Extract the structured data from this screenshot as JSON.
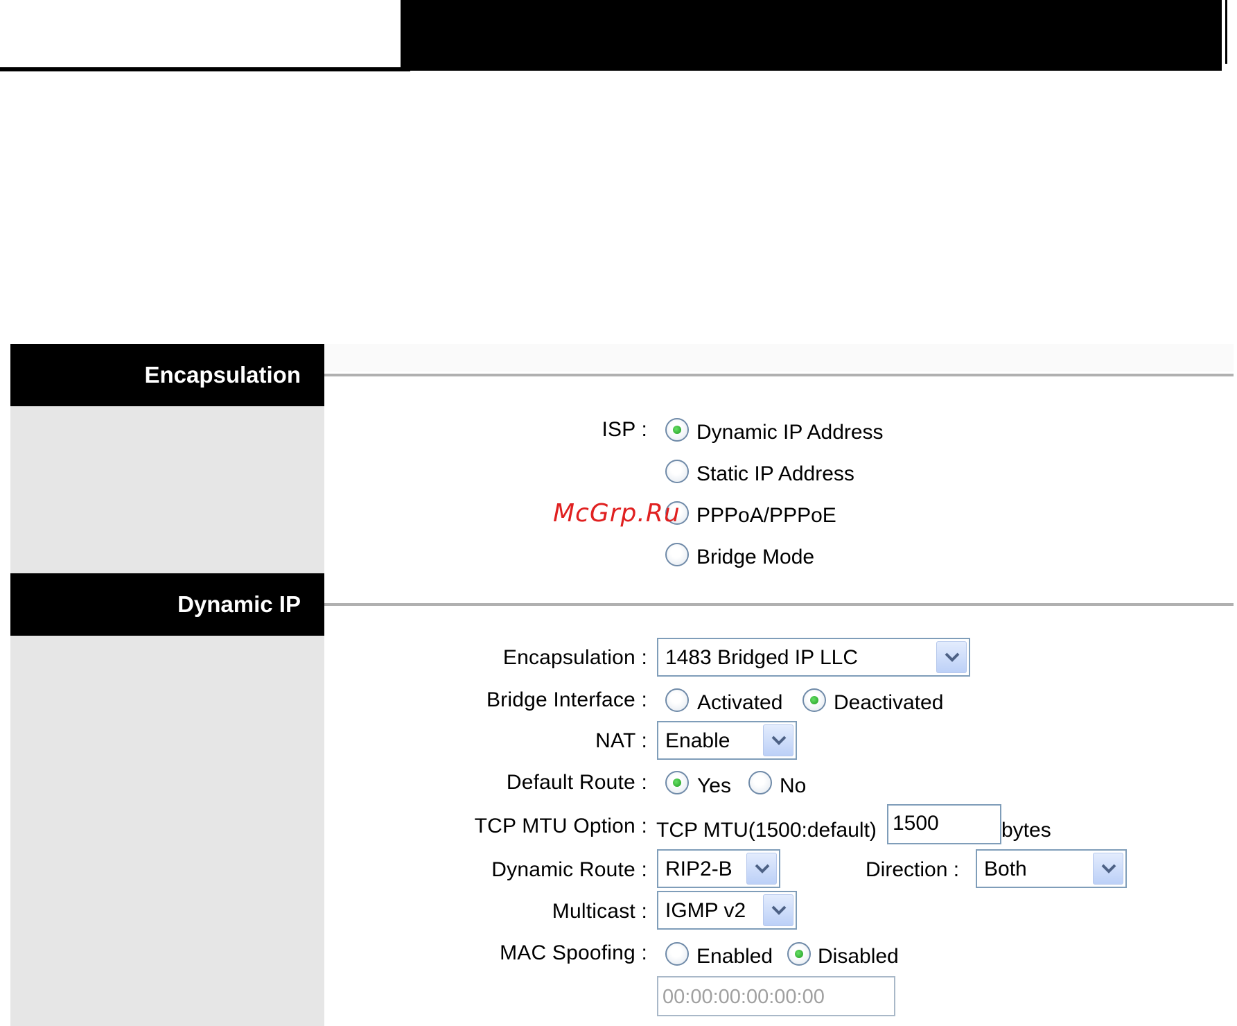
{
  "sections": {
    "encapsulation": {
      "title": "Encapsulation"
    },
    "dynamic_ip": {
      "title": "Dynamic IP"
    }
  },
  "isp": {
    "label": "ISP :",
    "options": [
      "Dynamic IP Address",
      "Static IP Address",
      "PPPoA/PPPoE",
      "Bridge Mode"
    ],
    "selected": "Dynamic IP Address"
  },
  "form": {
    "encapsulation": {
      "label": "Encapsulation :",
      "value": "1483 Bridged IP LLC"
    },
    "bridge_interface": {
      "label": "Bridge Interface :",
      "options": [
        "Activated",
        "Deactivated"
      ],
      "selected": "Deactivated"
    },
    "nat": {
      "label": "NAT :",
      "value": "Enable"
    },
    "default_route": {
      "label": "Default Route :",
      "options": [
        "Yes",
        "No"
      ],
      "selected": "Yes"
    },
    "tcp_mtu": {
      "label": "TCP MTU Option :",
      "prefix": "TCP MTU(1500:default)",
      "value": "1500",
      "suffix": "bytes"
    },
    "dynamic_route": {
      "label": "Dynamic Route :",
      "value": "RIP2-B"
    },
    "direction": {
      "label": "Direction :",
      "value": "Both"
    },
    "multicast": {
      "label": "Multicast :",
      "value": "IGMP v2"
    },
    "mac_spoofing": {
      "label": "MAC Spoofing :",
      "options": [
        "Enabled",
        "Disabled"
      ],
      "selected": "Disabled",
      "mac_value": "00:00:00:00:00:00"
    }
  },
  "watermark": "McGrp.Ru",
  "icons": {
    "dropdown": "chevron-down-icon",
    "radio": "radio-icon"
  },
  "colors": {
    "header": "#000000",
    "left_panel": "#e6e6e6",
    "divider": "#b0b0b0",
    "radio_selected": "#1f9a1f",
    "watermark": "#e02020"
  }
}
